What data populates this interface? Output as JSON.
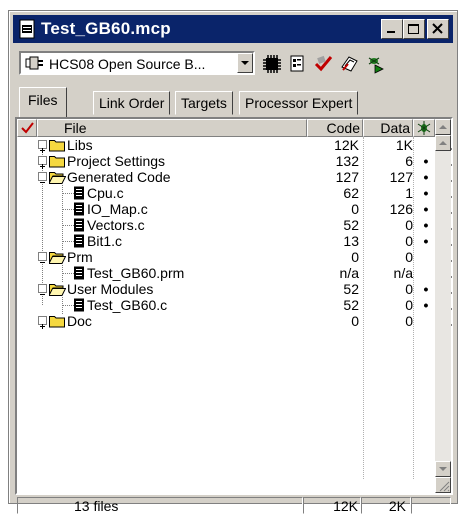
{
  "window": {
    "title": "Test_GB60.mcp"
  },
  "toolbar": {
    "target_combo": "HCS08 Open Source B..."
  },
  "tabs": [
    "Files",
    "Link Order",
    "Targets",
    "Processor Expert"
  ],
  "columns": {
    "file": "File",
    "code": "Code",
    "data": "Data"
  },
  "rows": [
    {
      "name": "Libs",
      "code": "12K",
      "data": "1K",
      "dot": ""
    },
    {
      "name": "Project Settings",
      "code": "132",
      "data": "6",
      "dot": "•"
    },
    {
      "name": "Generated Code",
      "code": "127",
      "data": "127",
      "dot": "•"
    },
    {
      "name": "Cpu.c",
      "code": "62",
      "data": "1",
      "dot": "•"
    },
    {
      "name": "IO_Map.c",
      "code": "0",
      "data": "126",
      "dot": "•"
    },
    {
      "name": "Vectors.c",
      "code": "52",
      "data": "0",
      "dot": "•"
    },
    {
      "name": "Bit1.c",
      "code": "13",
      "data": "0",
      "dot": "•"
    },
    {
      "name": "Prm",
      "code": "0",
      "data": "0",
      "dot": ""
    },
    {
      "name": "Test_GB60.prm",
      "code": "n/a",
      "data": "n/a",
      "dot": ""
    },
    {
      "name": "User Modules",
      "code": "52",
      "data": "0",
      "dot": "•"
    },
    {
      "name": "Test_GB60.c",
      "code": "52",
      "data": "0",
      "dot": "•"
    },
    {
      "name": "Doc",
      "code": "0",
      "data": "0",
      "dot": ""
    }
  ],
  "status": {
    "files": "13 files",
    "code_total": "12K",
    "data_total": "2K"
  },
  "colors": {
    "title_bar": "#0a246a",
    "folder": "#f5d840",
    "chrome": "#d4d0c8"
  }
}
